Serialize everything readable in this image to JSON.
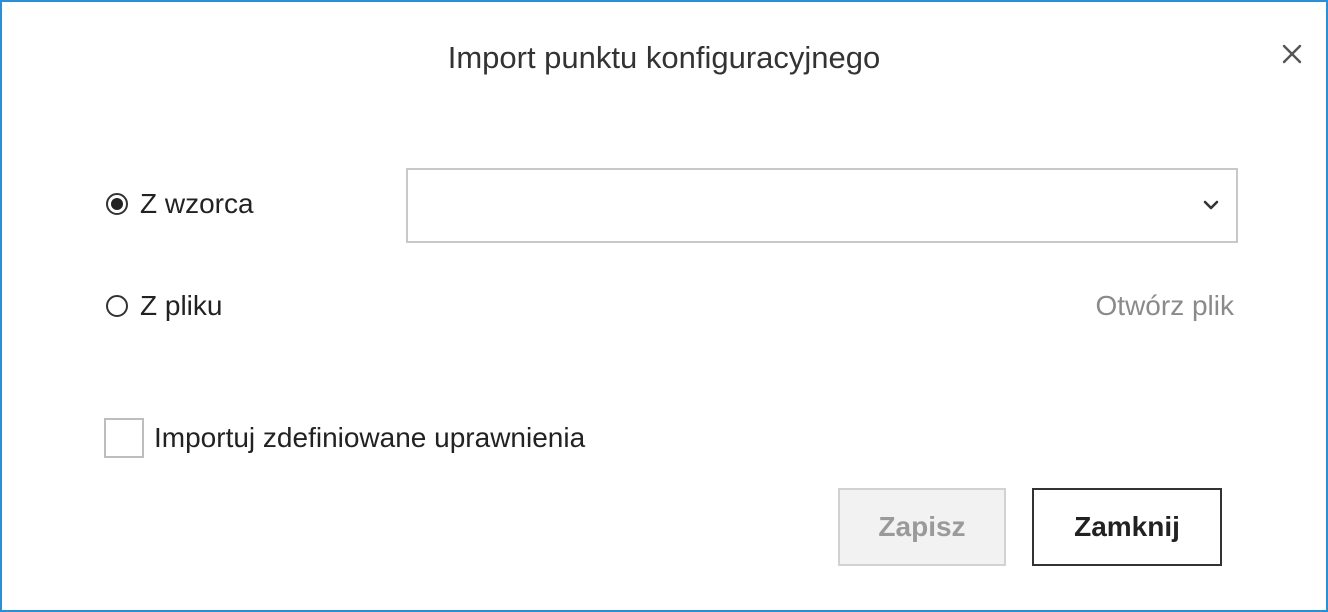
{
  "dialog": {
    "title": "Import punktu konfiguracyjnego"
  },
  "source": {
    "template_label": "Z wzorca",
    "template_selected": true,
    "template_select_value": "",
    "file_label": "Z pliku",
    "file_selected": false,
    "open_file_label": "Otwórz plik"
  },
  "options": {
    "import_permissions_label": "Importuj zdefiniowane uprawnienia",
    "import_permissions_checked": false
  },
  "buttons": {
    "save_label": "Zapisz",
    "save_enabled": false,
    "close_label": "Zamknij"
  },
  "colors": {
    "window_border": "#2b8fd6",
    "disabled_text": "#9a9a9a",
    "link_text": "#8a8a8a"
  },
  "icons": {
    "close": "close-icon",
    "dropdown": "chevron-down-icon"
  }
}
